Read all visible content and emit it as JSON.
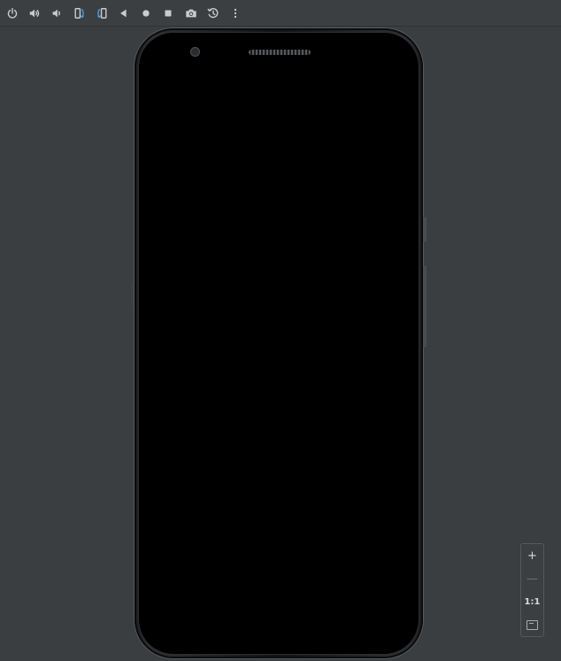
{
  "toolbar": {
    "buttons": [
      {
        "name": "power-button",
        "icon": "power-icon"
      },
      {
        "name": "volume-up-button",
        "icon": "volume-up-icon"
      },
      {
        "name": "volume-down-button",
        "icon": "volume-down-icon"
      },
      {
        "name": "rotate-left-button",
        "icon": "rotate-left-icon"
      },
      {
        "name": "rotate-right-button",
        "icon": "rotate-right-icon"
      },
      {
        "name": "back-button",
        "icon": "back-triangle-icon"
      },
      {
        "name": "home-button",
        "icon": "home-circle-icon"
      },
      {
        "name": "overview-button",
        "icon": "overview-square-icon"
      },
      {
        "name": "screenshot-button",
        "icon": "camera-icon"
      },
      {
        "name": "snapshot-button",
        "icon": "history-icon"
      },
      {
        "name": "more-button",
        "icon": "more-vertical-icon"
      }
    ]
  },
  "zoom": {
    "zoom_in_label": "+",
    "zoom_out_label": "—",
    "actual_size_label": "1:1",
    "fit_icon": "fit-screen-icon"
  },
  "colors": {
    "background": "#3b3e40",
    "toolbar": "#3c3f41",
    "icon": "#c9cbcd",
    "accent": "#4a9ce0",
    "screen": "#000000"
  }
}
